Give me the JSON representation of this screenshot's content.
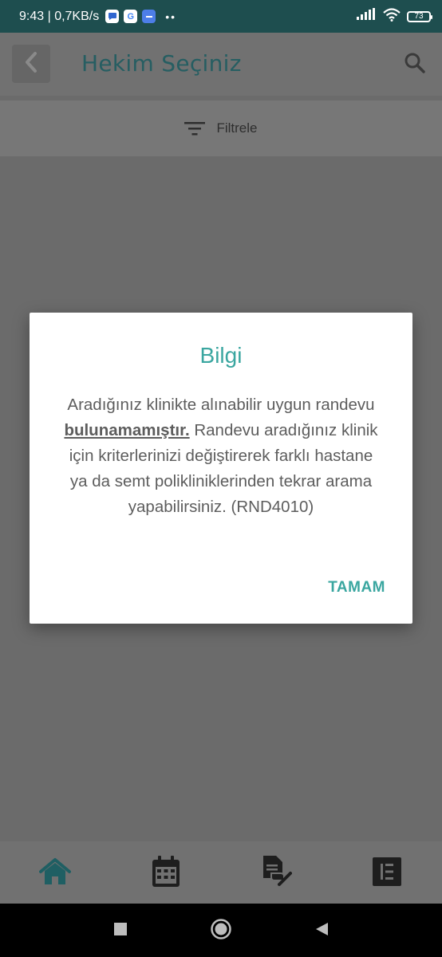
{
  "status_bar": {
    "time_and_speed": "9:43 | 0,7KB/s",
    "google_glyph": "G",
    "more_dots": "••",
    "battery_level": "73",
    "icons": [
      "message-icon",
      "google-icon",
      "app-icon",
      "signal-icon",
      "wifi-icon",
      "battery-icon"
    ]
  },
  "header": {
    "title": "Hekim Seçiniz",
    "icons": [
      "chevron-left-icon",
      "search-icon"
    ]
  },
  "filter": {
    "label": "Filtrele",
    "icon": "filter-icon"
  },
  "dialog": {
    "title": "Bilgi",
    "message_before": "Aradığınız klinikte alınabilir uygun randevu ",
    "message_emphasis": "bulunamamıştır.",
    "message_after": " Randevu aradığınız klinik için kriterlerinizi değiştirerek farklı hastane ya da semt polikliniklerinden tekrar arama yapabilirsiniz. (RND4010)",
    "ok_label": "TAMAM"
  },
  "bottom_nav": {
    "items": [
      "home-icon",
      "calendar-icon",
      "records-icon",
      "list-icon"
    ]
  },
  "system_nav": {
    "items": [
      "recent-apps-icon",
      "home-circle-icon",
      "back-triangle-icon"
    ]
  },
  "colors": {
    "accent": "#3aa6a0",
    "status_bar": "#1e4e4f",
    "overlay": "#6b6b6b"
  }
}
